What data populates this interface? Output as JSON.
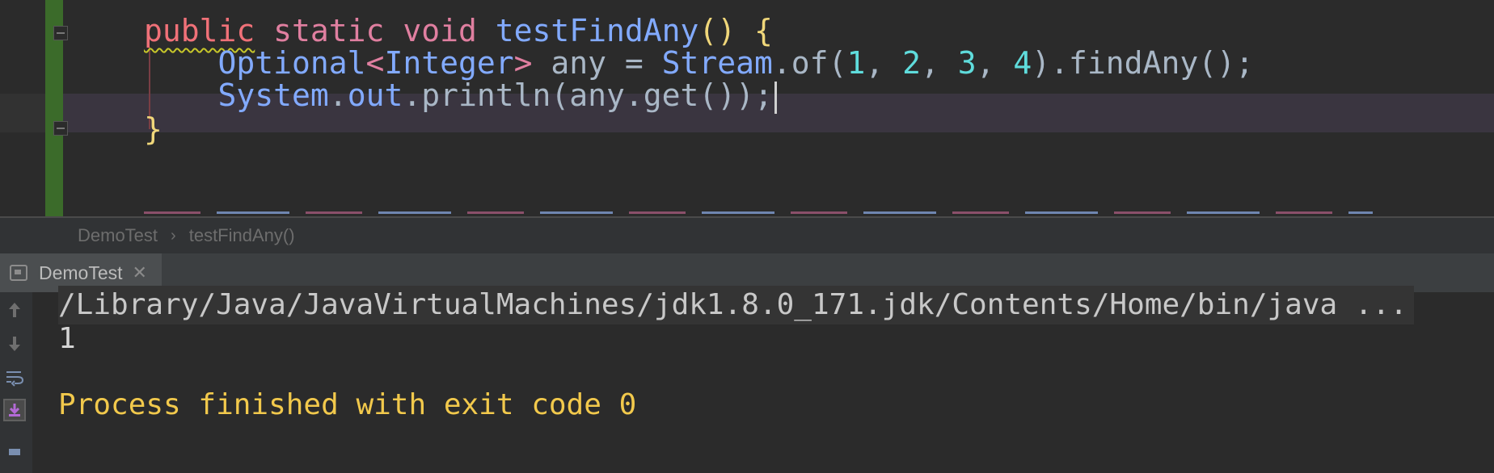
{
  "editor": {
    "lines": [
      {
        "modifier1": "public",
        "modifier2": " static ",
        "ret_type": "void",
        "space": " ",
        "method_name": "testFindAny",
        "parens": "()",
        "open_brace": " {"
      },
      {
        "indent": "    ",
        "type_optional": "Optional",
        "lt": "<",
        "type_integer": "Integer",
        "gt": ">",
        "var_decl": " any = ",
        "stream": "Stream",
        "of_call": ".of(",
        "n1": "1",
        "c1": ", ",
        "n2": "2",
        "c2": ", ",
        "n3": "3",
        "c3": ", ",
        "n4": "4",
        "tail": ").findAny();"
      },
      {
        "indent": "    ",
        "system": "System",
        "dot1": ".",
        "out": "out",
        "rest": ".println(any.get());"
      },
      {
        "close_brace": "}"
      }
    ]
  },
  "breadcrumb": {
    "class_name": "DemoTest",
    "separator": "›",
    "method": "testFindAny()"
  },
  "run_panel": {
    "tab_label": "DemoTest",
    "close_glyph": "✕",
    "console_lines": {
      "command": "/Library/Java/JavaVirtualMachines/jdk1.8.0_171.jdk/Contents/Home/bin/java ...",
      "output": "1",
      "exit": "Process finished with exit code 0"
    },
    "side_icons": [
      "up-arrow-icon",
      "down-arrow-icon",
      "soft-wrap-icon",
      "scroll-to-end-icon"
    ]
  },
  "colors": {
    "keyword": "#f07178",
    "type": "#82aaff",
    "number": "#5fdcdc",
    "brace": "#f0d77a",
    "exit_text": "#f2c94c",
    "vcs_bar": "#3b6b2a"
  }
}
